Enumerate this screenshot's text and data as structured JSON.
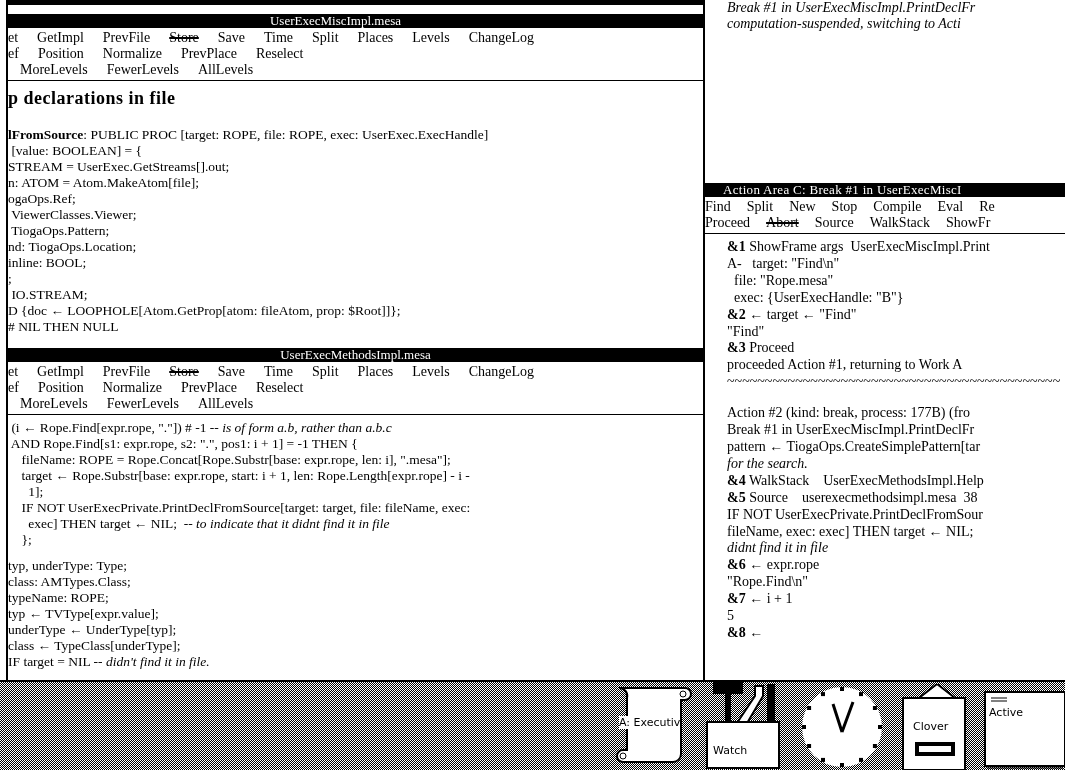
{
  "viewers": [
    {
      "title": "UserExecMiscImpl.mesa",
      "menu_rows": [
        [
          {
            "label": "et",
            "disabled": false
          },
          {
            "label": "GetImpl",
            "disabled": false
          },
          {
            "label": "PrevFile",
            "disabled": false
          },
          {
            "label": "Store",
            "disabled": true
          },
          {
            "label": "Save",
            "disabled": false
          },
          {
            "label": "Time",
            "disabled": false
          },
          {
            "label": "Split",
            "disabled": false
          },
          {
            "label": "Places",
            "disabled": false
          },
          {
            "label": "Levels",
            "disabled": false
          },
          {
            "label": "ChangeLog",
            "disabled": false
          }
        ],
        [
          {
            "label": "ef",
            "disabled": false
          },
          {
            "label": "Position",
            "disabled": false
          },
          {
            "label": "Normalize",
            "disabled": false
          },
          {
            "label": "PrevPlace",
            "disabled": false
          },
          {
            "label": "Reselect",
            "disabled": false
          }
        ],
        [
          {
            "label": "MoreLevels",
            "disabled": false
          },
          {
            "label": "FewerLevels",
            "disabled": false
          },
          {
            "label": "AllLevels",
            "disabled": false
          }
        ]
      ],
      "heading": "p declarations in file",
      "blocks": [
        [
          "**lFromSource**: PUBLIC PROC [target: ROPE, file: ROPE, exec: UserExec.ExecHandle]",
          " [value: BOOLEAN] = {",
          "STREAM = UserExec.GetStreams[].out;",
          "n: ATOM = Atom.MakeAtom[file];",
          "ogaOps.Ref;",
          " ViewerClasses.Viewer;",
          " TiogaOps.Pattern;",
          "nd: TiogaOps.Location;",
          "inline: BOOL;",
          ";",
          " IO.STREAM;",
          "D {doc ← LOOPHOLE[Atom.GetProp[atom: fileAtom, prop: $Root]]};",
          "# NIL THEN NULL"
        ]
      ]
    },
    {
      "title": "UserExecMethodsImpl.mesa",
      "menu_rows": [
        [
          {
            "label": "et",
            "disabled": false
          },
          {
            "label": "GetImpl",
            "disabled": false
          },
          {
            "label": "PrevFile",
            "disabled": false
          },
          {
            "label": "Store",
            "disabled": true
          },
          {
            "label": "Save",
            "disabled": false
          },
          {
            "label": "Time",
            "disabled": false
          },
          {
            "label": "Split",
            "disabled": false
          },
          {
            "label": "Places",
            "disabled": false
          },
          {
            "label": "Levels",
            "disabled": false
          },
          {
            "label": "ChangeLog",
            "disabled": false
          }
        ],
        [
          {
            "label": "ef",
            "disabled": false
          },
          {
            "label": "Position",
            "disabled": false
          },
          {
            "label": "Normalize",
            "disabled": false
          },
          {
            "label": "PrevPlace",
            "disabled": false
          },
          {
            "label": "Reselect",
            "disabled": false
          }
        ],
        [
          {
            "label": "MoreLevels",
            "disabled": false
          },
          {
            "label": "FewerLevels",
            "disabled": false
          },
          {
            "label": "AllLevels",
            "disabled": false
          }
        ]
      ],
      "blocks": [
        [
          " (i ← Rope.Find[expr.rope, \".\"]) # -1 -- *is of form a.b, rather than a.b.c*",
          " AND Rope.Find[s1: expr.rope, s2: \".\", pos1: i + 1] = -1 THEN {",
          "    fileName: ROPE = Rope.Concat[Rope.Substr[base: expr.rope, len: i], \".mesa\"];",
          "    target ← Rope.Substr[base: expr.rope, start: i + 1, len: Rope.Length[expr.rope] - i -",
          "      1];",
          "    IF NOT UserExecPrivate.PrintDeclFromSource[target: target, file: fileName, exec:",
          "      exec] THEN target ← NIL;  -- *to indicate that it didnt find it in file*",
          "    };"
        ],
        [
          "typ, underType: Type;",
          "class: AMTypes.Class;",
          "typeName: ROPE;",
          "typ ← TVType[expr.value];",
          "underType ← UnderType[typ];",
          "class ← TypeClass[underType];",
          "IF target = NIL -- *didn't find it in file.*"
        ]
      ]
    }
  ],
  "work_area": {
    "lines": [
      "Break #1 in UserExecMiscImpl.PrintDeclFr",
      "computation-suspended, switching to Acti"
    ]
  },
  "action_area": {
    "title": "Action Area C: Break #1 in UserExecMiscI",
    "menu_rows": [
      [
        {
          "label": "Find",
          "disabled": false
        },
        {
          "label": "Split",
          "disabled": false
        },
        {
          "label": "New",
          "disabled": false
        },
        {
          "label": "Stop",
          "disabled": false
        },
        {
          "label": "Compile",
          "disabled": false
        },
        {
          "label": "Eval",
          "disabled": false
        },
        {
          "label": "Re",
          "disabled": false
        }
      ],
      [
        {
          "label": "Proceed",
          "disabled": false
        },
        {
          "label": "Abort",
          "disabled": true
        },
        {
          "label": "Source",
          "disabled": false
        },
        {
          "label": "WalkStack",
          "disabled": false
        },
        {
          "label": "ShowFr",
          "disabled": false
        }
      ]
    ],
    "blocks": [
      [
        "**&1** ShowFrame args  UserExecMiscImpl.Print",
        "A-   target: \"Find\\n\"",
        "  file: \"Rope.mesa\"",
        "  exec: {UserExecHandle: \"B\"}",
        "**&2** ← target ← \"Find\"",
        "\"Find\"",
        "**&3** Proceed",
        "proceeded Action #1, returning to Work A",
        "~~~~~~~~~~~~~~~~~~~~~~~~~~~~~~~~~~~~~~~~~~~~"
      ],
      [
        "Action #2 (kind: break, process: 177B) (fro",
        "Break #1 in UserExecMiscImpl.PrintDeclFr",
        "pattern ← TiogaOps.CreateSimplePattern[tar",
        "*for the search.*",
        "**&4** WalkStack    UserExecMethodsImpl.Help",
        "**&5** Source    userexecmethodsimpl.mesa  38",
        "IF NOT UserExecPrivate.PrintDeclFromSour",
        "fileName, exec: exec] THEN target ← NIL;",
        "*didnt find it in file*",
        "**&6** ← expr.rope",
        "\"Rope.Find\\n\"",
        "**&7** ← i + 1",
        "5",
        "**&8** ←"
      ]
    ]
  },
  "desktop_icons": [
    {
      "kind": "scroll",
      "label": "A: Executiv"
    },
    {
      "kind": "toolbox",
      "label": "Watch"
    },
    {
      "kind": "clock"
    },
    {
      "kind": "cabinet",
      "label": "Clover"
    },
    {
      "kind": "document",
      "label": "Active"
    }
  ]
}
